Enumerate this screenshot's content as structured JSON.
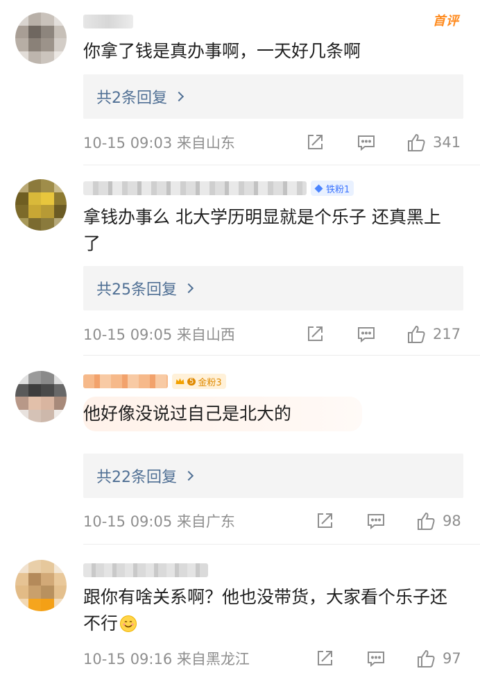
{
  "comments": [
    {
      "first_tag": "首评",
      "badge": "",
      "text": "你拿了钱是真办事啊，一天好几条啊",
      "replies": "共2条回复",
      "time": "10-15 09:03",
      "location": "来自山东",
      "likes": "341"
    },
    {
      "badge": "铁粉1",
      "text": "拿钱办事么 北大学历明显就是个乐子 还真黑上了",
      "replies": "共25条回复",
      "time": "10-15 09:05",
      "location": "来自山西",
      "likes": "217"
    },
    {
      "badge": "金粉3",
      "badge_level": "5",
      "text": "他好像没说过自己是北大的",
      "replies": "共22条回复",
      "time": "10-15 09:05",
      "location": "来自广东",
      "likes": "98"
    },
    {
      "badge": "",
      "text": "跟你有啥关系啊？他也没带货，大家看个乐子还不行",
      "emoji": "smiling-face",
      "time": "10-15 09:16",
      "location": "来自黑龙江",
      "likes": "97"
    }
  ],
  "icons": {
    "share": "share-icon",
    "comment": "comment-icon",
    "like": "thumbs-up-icon"
  },
  "colors": {
    "link": "#4f6f94",
    "meta": "#8e8e8e",
    "first_tag": "#ff8a1d",
    "iron_badge": "#3b73ff",
    "gold_badge": "#e08a00"
  }
}
